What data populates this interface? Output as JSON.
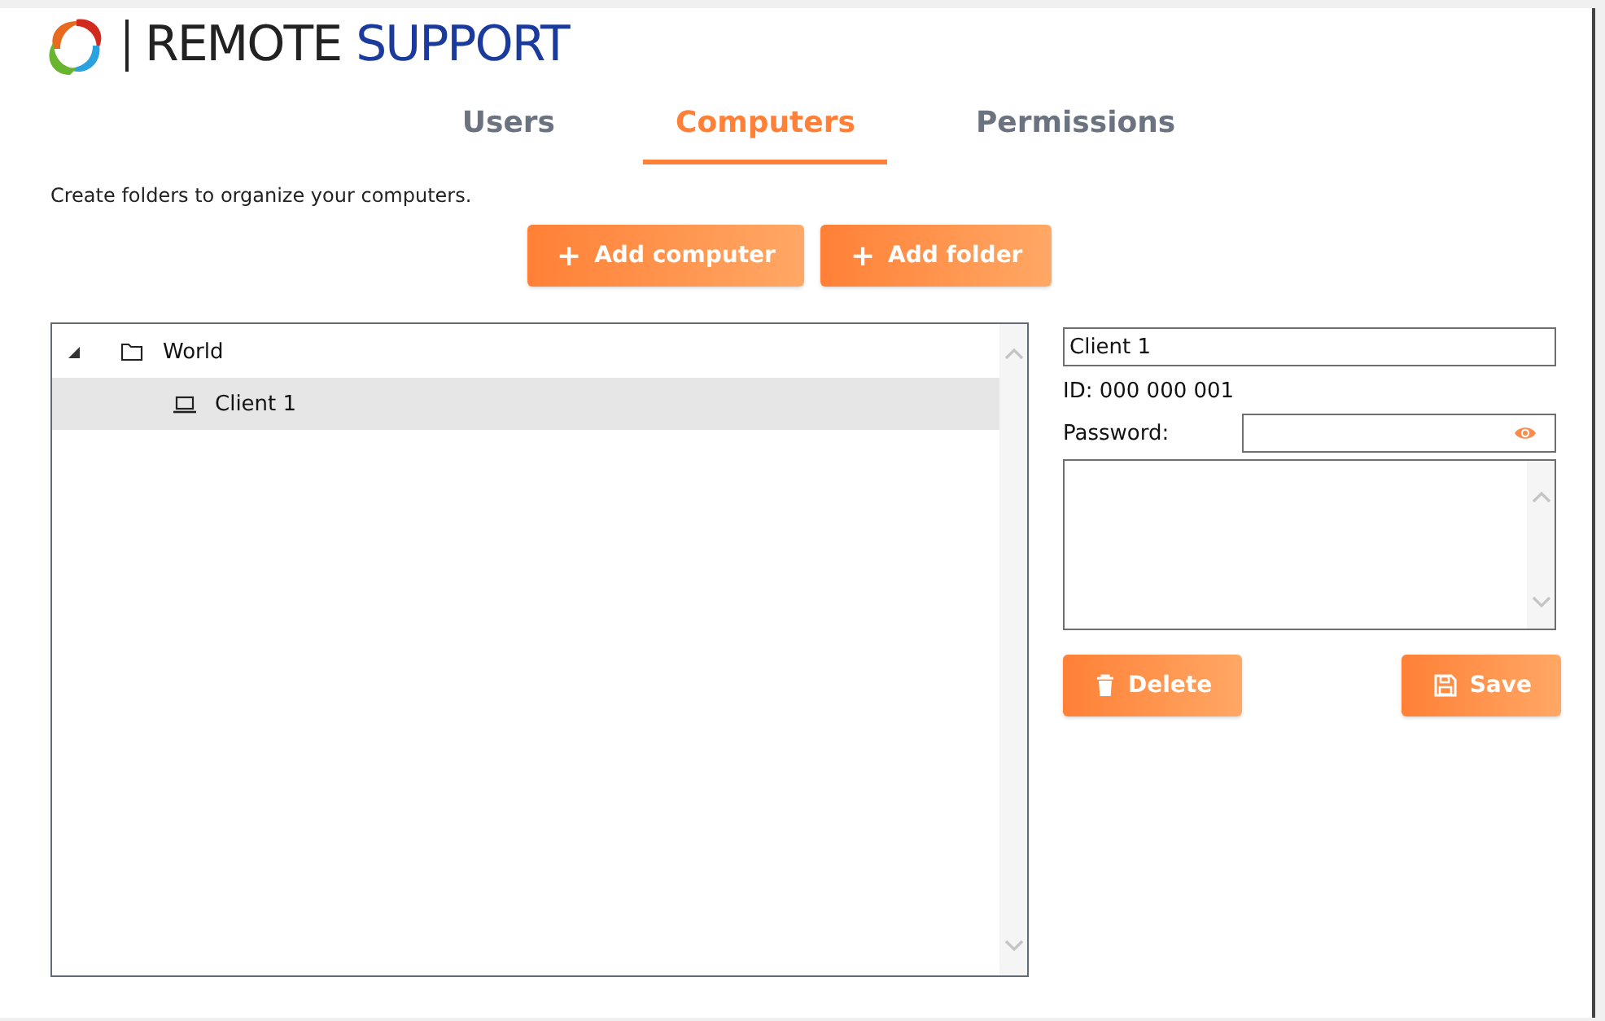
{
  "logo": {
    "brand_left": "REMOTE",
    "brand_right": "SUPPORT"
  },
  "tabs": [
    {
      "label": "Users",
      "selected": false
    },
    {
      "label": "Computers",
      "selected": true
    },
    {
      "label": "Permissions",
      "selected": false
    }
  ],
  "hint": "Create folders to organize your computers.",
  "actions": [
    {
      "label": "Add computer",
      "icon": "+"
    },
    {
      "label": "Add folder",
      "icon": "+"
    }
  ],
  "tree": [
    {
      "label": "World",
      "kind": "folder",
      "expanded": true,
      "selected": false,
      "children": [
        {
          "label": "Client 1",
          "kind": "computer",
          "selected": true
        }
      ]
    }
  ],
  "details": {
    "name": "Client 1",
    "id": "ID: 000 000 001",
    "password_label": "Password:",
    "buttons": [
      {
        "label": "Delete",
        "kind": "delete"
      },
      {
        "label": "Save",
        "kind": "save"
      }
    ]
  }
}
